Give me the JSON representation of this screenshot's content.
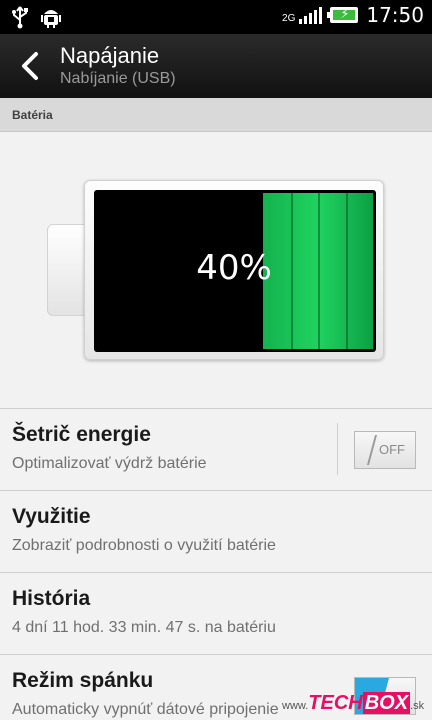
{
  "status_bar": {
    "time": "17:50",
    "network": "2G",
    "icons": [
      "usb-icon",
      "android-debug-icon",
      "signal-icon",
      "battery-charging-icon"
    ],
    "battery_color": "#3dbb3d"
  },
  "action_bar": {
    "title": "Napájanie",
    "subtitle": "Nabíjanie (USB)",
    "back_icon": "chevron-left-icon"
  },
  "section": {
    "label": "Batéria"
  },
  "battery": {
    "percent_label": "40%",
    "level": 0.4,
    "fill_color": "#1fd35f"
  },
  "list": {
    "items": [
      {
        "title": "Šetrič energie",
        "desc": "Optimalizovať výdrž batérie",
        "toggle": "OFF"
      },
      {
        "title": "Využitie",
        "desc": "Zobraziť podrobnosti o využití batérie"
      },
      {
        "title": "História",
        "desc": "4 dní 11 hod. 33 min. 47 s. na batériu"
      },
      {
        "title": "Režim spánku",
        "desc": "Automaticky vypnúť dátové pripojenie"
      }
    ]
  },
  "watermark": {
    "prefix": "www.",
    "brand_a": "TECH",
    "brand_b": "BOX",
    "suffix": ".sk"
  }
}
